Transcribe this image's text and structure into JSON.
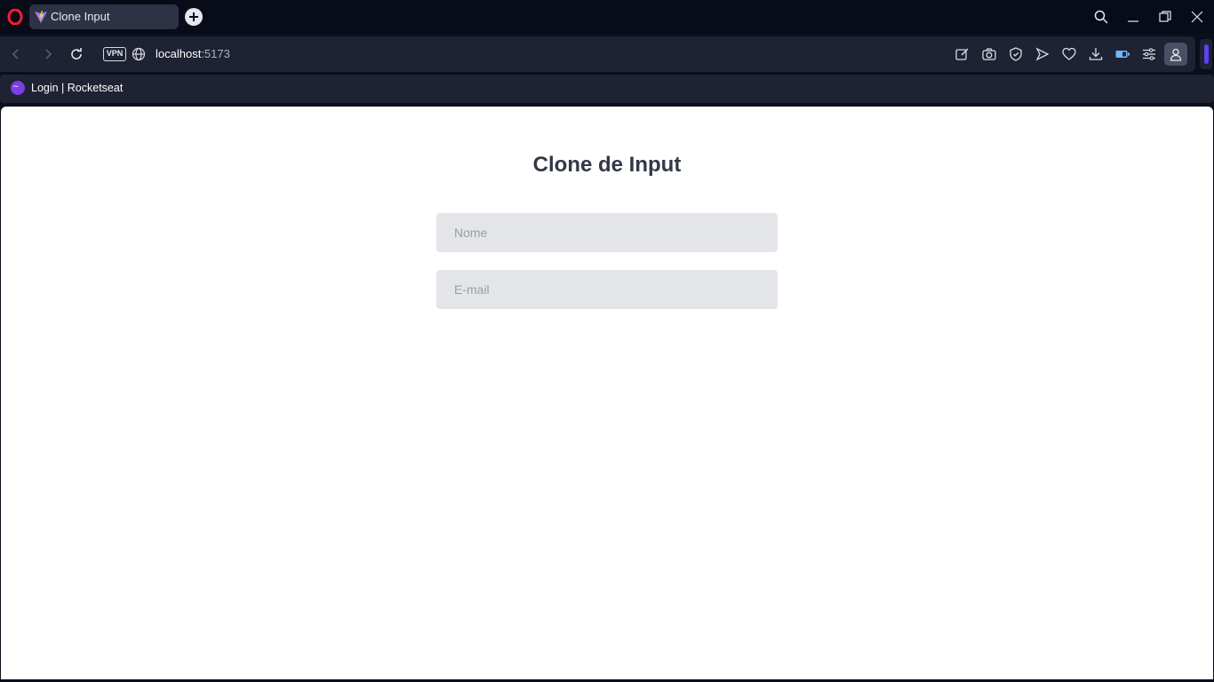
{
  "browser": {
    "tab": {
      "title": "Clone Input"
    },
    "address": {
      "host": "localhost",
      "port": ":5173",
      "vpn_label": "VPN"
    },
    "bookmarks": [
      {
        "label": "Login | Rocketseat"
      }
    ]
  },
  "page": {
    "title": "Clone de Input",
    "fields": {
      "name": {
        "placeholder": "Nome",
        "value": ""
      },
      "email": {
        "placeholder": "E-mail",
        "value": ""
      }
    }
  },
  "icons": {
    "browser_logo": "opera-logo-icon",
    "tab_favicon": "vite-logo-icon",
    "bookmark_favicon": "rocketseat-icon"
  },
  "colors": {
    "page_title": "#323846",
    "input_background": "#e4e5e9",
    "placeholder": "#9a9da6",
    "accent": "#5b43f0",
    "browser_logo": "#ff1b2d"
  }
}
